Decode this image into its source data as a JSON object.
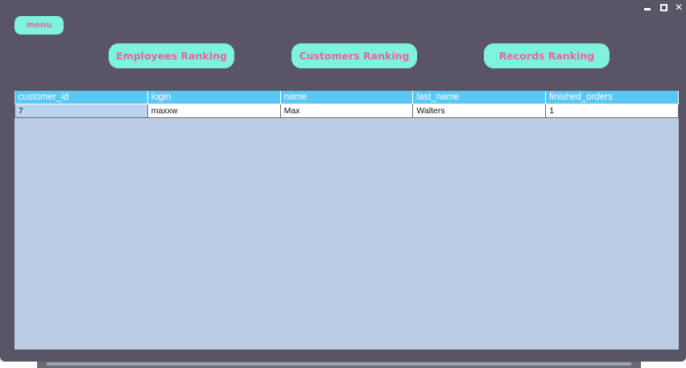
{
  "window_controls": {
    "minimize_icon": "minimize-icon",
    "maximize_icon": "maximize-icon",
    "close_symbol": "✕"
  },
  "menu": {
    "label": "menu"
  },
  "ranking_buttons": {
    "employees": "Employees Ranking",
    "customers": "Customers Ranking",
    "records": "Records Ranking"
  },
  "colors": {
    "background": "#5a5564",
    "button_bg": "#7ef2de",
    "button_text": "#e0699e",
    "table_header": "#5ac8f5",
    "grid_empty": "#bccde6"
  },
  "table": {
    "columns": [
      "customer_id",
      "login",
      "name",
      "last_name",
      "finished_orders"
    ],
    "rows": [
      [
        "7",
        "maxxw",
        "Max",
        "Walters",
        "1"
      ]
    ]
  }
}
